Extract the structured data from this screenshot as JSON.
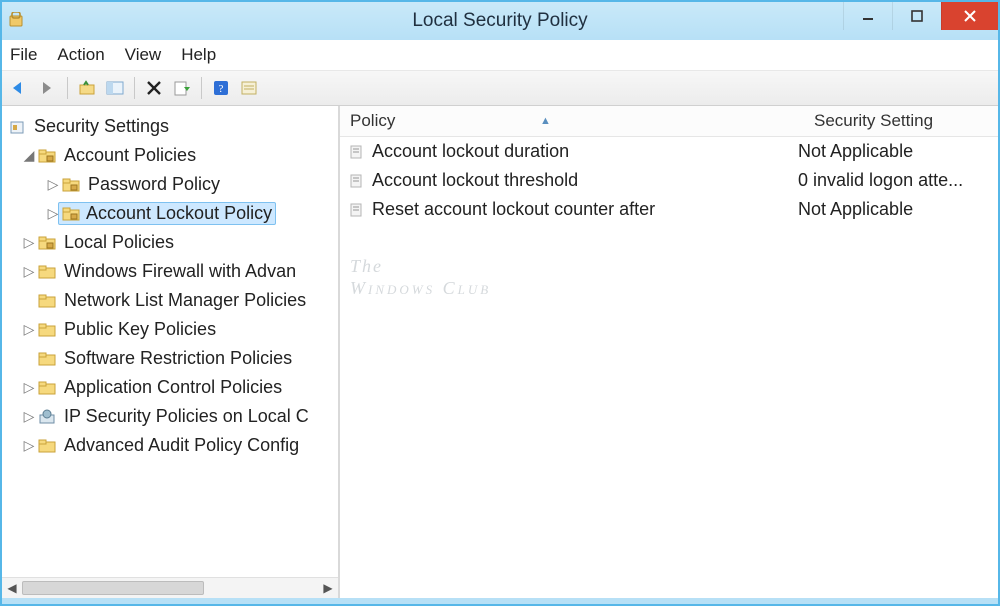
{
  "window": {
    "title": "Local Security Policy"
  },
  "menu": {
    "file": "File",
    "action": "Action",
    "view": "View",
    "help": "Help"
  },
  "tree": {
    "root": "Security Settings",
    "nodes": [
      {
        "label": "Account Policies",
        "expanded": true,
        "children": [
          {
            "label": "Password Policy"
          },
          {
            "label": "Account Lockout Policy",
            "selected": true
          }
        ]
      },
      {
        "label": "Local Policies"
      },
      {
        "label": "Windows Firewall with Advanced Security",
        "display": "Windows Firewall with Advan"
      },
      {
        "label": "Network List Manager Policies",
        "no_twisty": true
      },
      {
        "label": "Public Key Policies"
      },
      {
        "label": "Software Restriction Policies",
        "no_twisty": true
      },
      {
        "label": "Application Control Policies"
      },
      {
        "label": "IP Security Policies on Local Computer",
        "display": "IP Security Policies on Local C",
        "icon": "ipsec"
      },
      {
        "label": "Advanced Audit Policy Configuration",
        "display": "Advanced Audit Policy Config"
      }
    ]
  },
  "list": {
    "columns": {
      "policy": "Policy",
      "setting": "Security Setting"
    },
    "rows": [
      {
        "policy": "Account lockout duration",
        "setting": "Not Applicable"
      },
      {
        "policy": "Account lockout threshold",
        "setting": "0 invalid logon atte..."
      },
      {
        "policy": "Reset account lockout counter after",
        "setting": "Not Applicable"
      }
    ]
  },
  "watermark": {
    "line1": "The",
    "line2": "Windows Club"
  }
}
